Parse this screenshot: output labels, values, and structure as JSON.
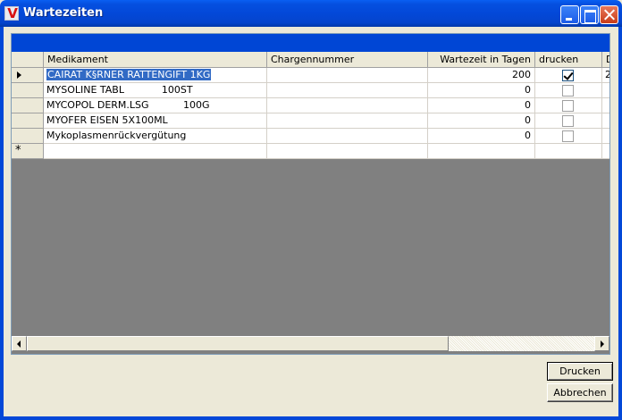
{
  "window": {
    "title": "Wartezeiten",
    "icon": "app-v-logo-icon",
    "icon_glyph": "V"
  },
  "grid": {
    "columns": [
      "Medikament",
      "Chargennummer",
      "Wartezeit in Tagen",
      "drucken",
      "D"
    ],
    "rows": [
      {
        "medikament": "CAIRAT K§RNER RATTENGIFT     1KG",
        "charge": "",
        "wartezeit": "200",
        "drucken": true,
        "extra": "2",
        "current": true
      },
      {
        "medikament": "MYSOLINE TABL            100ST",
        "charge": "",
        "wartezeit": "0",
        "drucken": false,
        "extra": ""
      },
      {
        "medikament": "MYCOPOL DERM.LSG           100G",
        "charge": "",
        "wartezeit": "0",
        "drucken": false,
        "extra": ""
      },
      {
        "medikament": "MYOFER EISEN 5X100ML",
        "charge": "",
        "wartezeit": "0",
        "drucken": false,
        "extra": ""
      },
      {
        "medikament": "Mykoplasmenrückvergütung",
        "charge": "",
        "wartezeit": "0",
        "drucken": false,
        "extra": ""
      }
    ],
    "new_row_marker": "*"
  },
  "buttons": {
    "print": "Drucken",
    "cancel": "Abbrechen"
  },
  "colors": {
    "caption": "#0046D5",
    "selection": "#316AC5",
    "empty_area": "#808080",
    "face": "#ECE9D8"
  }
}
